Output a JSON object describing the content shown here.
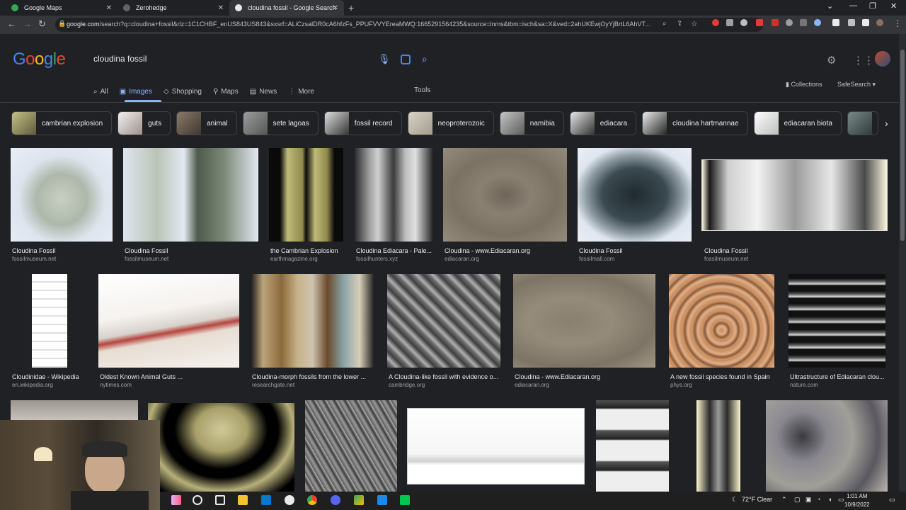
{
  "browser": {
    "tabs": [
      {
        "title": "Google Maps",
        "active": false
      },
      {
        "title": "Zerohedge",
        "active": false
      },
      {
        "title": "cloudina fossil - Google Search",
        "active": true
      }
    ],
    "url_host": "google.com",
    "url_rest": "/search?q=cloudina+fossil&rlz=1C1CHBF_enUS843US843&sxsrf=ALiCzsalDR0cA6hfzFs_PPUFVVYEreaMWQ:1665291564235&source=lnms&tbm=isch&sa=X&ved=2ahUKEwjOyYjBrtL6AhVT..."
  },
  "google": {
    "logo": "Google",
    "query": "cloudina fossil",
    "filters": [
      {
        "label": "All",
        "icon": "search-icon"
      },
      {
        "label": "Images",
        "icon": "image-icon"
      },
      {
        "label": "Shopping",
        "icon": "tag-icon"
      },
      {
        "label": "Maps",
        "icon": "pin-icon"
      },
      {
        "label": "News",
        "icon": "news-icon"
      },
      {
        "label": "More",
        "icon": "more-icon"
      }
    ],
    "tools": "Tools",
    "collections": "Collections",
    "safesearch": "SafeSearch"
  },
  "chips": [
    {
      "label": "cambrian explosion"
    },
    {
      "label": "guts"
    },
    {
      "label": "animal"
    },
    {
      "label": "sete lagoas"
    },
    {
      "label": "fossil record"
    },
    {
      "label": "neoproterozoic"
    },
    {
      "label": "namibia"
    },
    {
      "label": "ediacara"
    },
    {
      "label": "cloudina hartmannae"
    },
    {
      "label": "ediacaran biota"
    }
  ],
  "results_row1": [
    {
      "caption": "Cloudina Fossil",
      "source": "fossilmuseum.net"
    },
    {
      "caption": "Cloudina Fossil",
      "source": "fossilmuseum.net"
    },
    {
      "caption": "the Cambrian Explosion",
      "source": "earthmagazine.org"
    },
    {
      "caption": "Cloudina Ediacara - Pale...",
      "source": "fossilhunters.xyz"
    },
    {
      "caption": "Cloudina - www.Ediacaran.org",
      "source": "ediacaran.org"
    },
    {
      "caption": "Cloudina Fossil",
      "source": "fossilmall.com"
    },
    {
      "caption": "Cloudina Fossil",
      "source": "fossilmuseum.net"
    }
  ],
  "results_row2": [
    {
      "caption": "Cloudinidae - Wikipedia",
      "source": "en.wikipedia.org"
    },
    {
      "caption": "Oldest Known Animal Guts ...",
      "source": "nytimes.com"
    },
    {
      "caption": "Cloudina-morph fossils from the lower ...",
      "source": "researchgate.net"
    },
    {
      "caption": "A Cloudina-like fossil with evidence o...",
      "source": "cambridge.org"
    },
    {
      "caption": "Cloudina - www.Ediacaran.org",
      "source": "ediacaran.org"
    },
    {
      "caption": "A new fossil species found in Spain",
      "source": "phys.org"
    },
    {
      "caption": "Ultrastructure of Ediacaran clou...",
      "source": "nature.com"
    }
  ],
  "taskbar": {
    "weather": "72°F  Clear",
    "time": "1:01 AM",
    "date": "10/9/2022"
  }
}
